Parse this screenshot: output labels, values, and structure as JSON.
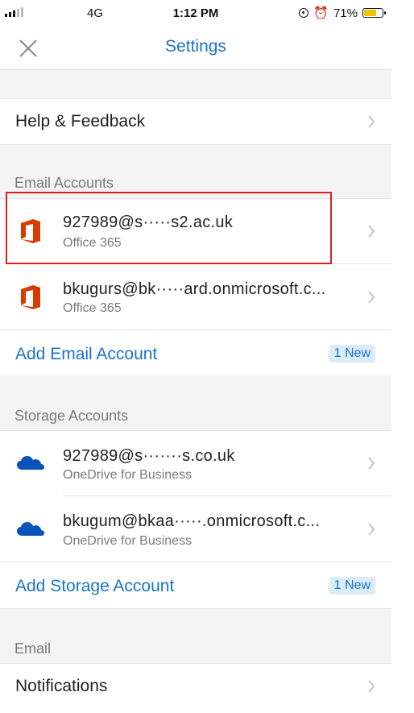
{
  "status_bar": {
    "network": "4G",
    "time": "1:12 PM",
    "battery": "71%",
    "battery_level": 0.71
  },
  "header": {
    "title": "Settings"
  },
  "help": {
    "label": "Help & Feedback"
  },
  "email_accounts": {
    "section_label": "Email Accounts",
    "items": [
      {
        "address": "927989@s·····s2.ac.uk",
        "type": "Office 365",
        "icon": "office-365-icon"
      },
      {
        "address": "bkugurs@bk·····ard.onmicrosoft.c...",
        "type": "Office 365",
        "icon": "office-365-icon"
      }
    ],
    "add_label": "Add Email Account",
    "new_badge": "1 New"
  },
  "storage_accounts": {
    "section_label": "Storage Accounts",
    "items": [
      {
        "address": "927989@s·······s.co.uk",
        "type": "OneDrive for Business",
        "icon": "onedrive-icon"
      },
      {
        "address": "bkugum@bkaa·····.onmicrosoft.c...",
        "type": "OneDrive for Business",
        "icon": "onedrive-icon"
      }
    ],
    "add_label": "Add Storage Account",
    "new_badge": "1 New"
  },
  "email": {
    "section_label": "Email",
    "notifications_label": "Notifications"
  },
  "colors": {
    "accent": "#1a73c8",
    "office_red": "#d83b01",
    "onedrive_blue": "#0a53b8",
    "highlight_red": "#e02020"
  }
}
